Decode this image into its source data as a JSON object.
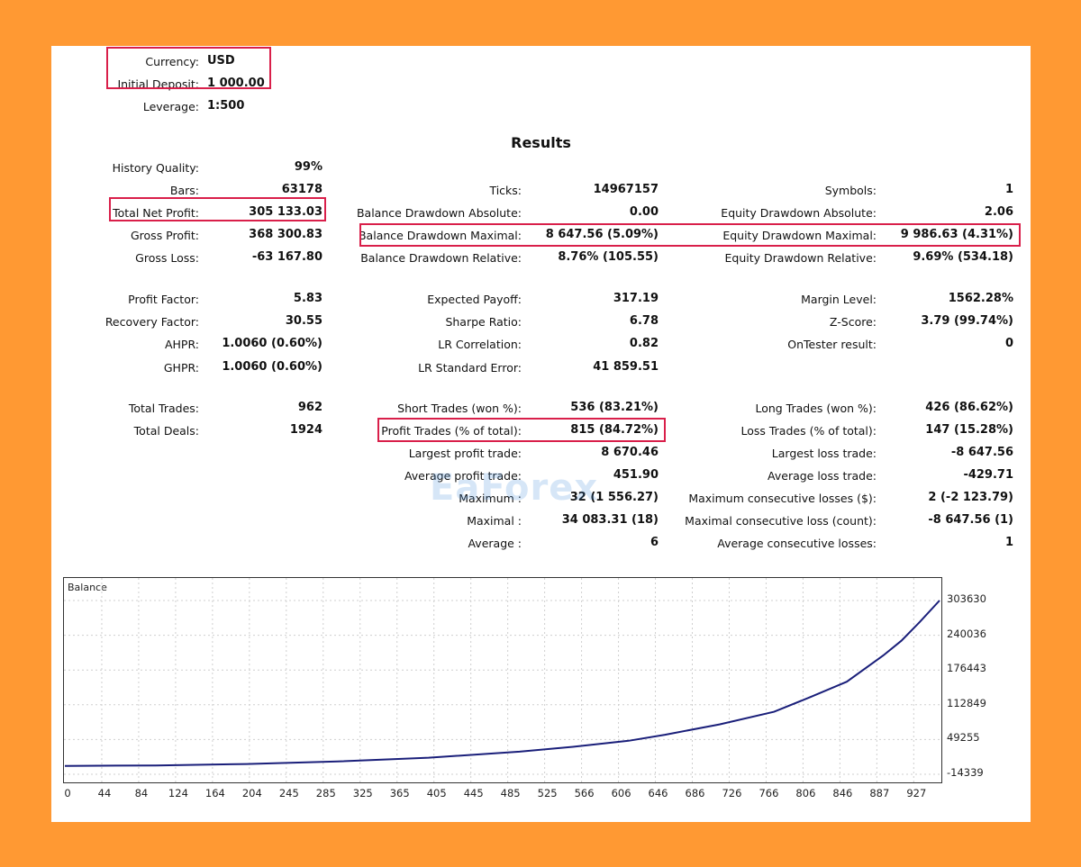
{
  "header": [
    {
      "label": "Currency:",
      "value": "USD"
    },
    {
      "label": "Initial Deposit:",
      "value": "1 000.00"
    },
    {
      "label": "Leverage:",
      "value": "1:500"
    }
  ],
  "results_title": "Results",
  "col1": [
    {
      "label": "History Quality:",
      "value": "99%"
    },
    {
      "label": "Bars:",
      "value": "63178"
    },
    {
      "label": "Total Net Profit:",
      "value": "305 133.03"
    },
    {
      "label": "Gross Profit:",
      "value": "368 300.83"
    },
    {
      "label": "Gross Loss:",
      "value": "-63 167.80"
    },
    {
      "label": "Profit Factor:",
      "value": "5.83"
    },
    {
      "label": "Recovery Factor:",
      "value": "30.55"
    },
    {
      "label": "AHPR:",
      "value": "1.0060 (0.60%)"
    },
    {
      "label": "GHPR:",
      "value": "1.0060 (0.60%)"
    },
    {
      "label": "Total Trades:",
      "value": "962"
    },
    {
      "label": "Total Deals:",
      "value": "1924"
    }
  ],
  "col2": [
    {
      "label": "Ticks:",
      "value": "14967157"
    },
    {
      "label": "Balance Drawdown Absolute:",
      "value": "0.00"
    },
    {
      "label": "Balance Drawdown Maximal:",
      "value": "8 647.56 (5.09%)"
    },
    {
      "label": "Balance Drawdown Relative:",
      "value": "8.76% (105.55)"
    },
    {
      "label": "Expected Payoff:",
      "value": "317.19"
    },
    {
      "label": "Sharpe Ratio:",
      "value": "6.78"
    },
    {
      "label": "LR Correlation:",
      "value": "0.82"
    },
    {
      "label": "LR Standard Error:",
      "value": "41 859.51"
    },
    {
      "label": "Short Trades (won %):",
      "value": "536 (83.21%)"
    },
    {
      "label": "Profit Trades (% of total):",
      "value": "815 (84.72%)"
    },
    {
      "label": "Largest profit trade:",
      "value": "8 670.46"
    },
    {
      "label": "Average profit trade:",
      "value": "451.90"
    },
    {
      "label": "Maximum :",
      "value": "32 (1 556.27)"
    },
    {
      "label": "Maximal :",
      "value": "34 083.31 (18)"
    },
    {
      "label": "Average :",
      "value": "6"
    }
  ],
  "col3": [
    {
      "label": "Symbols:",
      "value": "1"
    },
    {
      "label": "Equity Drawdown Absolute:",
      "value": "2.06"
    },
    {
      "label": "Equity Drawdown Maximal:",
      "value": "9 986.63 (4.31%)"
    },
    {
      "label": "Equity Drawdown Relative:",
      "value": "9.69% (534.18)"
    },
    {
      "label": "Margin Level:",
      "value": "1562.28%"
    },
    {
      "label": "Z-Score:",
      "value": "3.79 (99.74%)"
    },
    {
      "label": "OnTester result:",
      "value": "0"
    },
    {
      "label": "Long Trades (won %):",
      "value": "426 (86.62%)"
    },
    {
      "label": "Loss Trades (% of total):",
      "value": "147 (15.28%)"
    },
    {
      "label": "Largest loss trade:",
      "value": "-8 647.56"
    },
    {
      "label": "Average loss trade:",
      "value": "-429.71"
    },
    {
      "label": "Maximum consecutive losses ($):",
      "value": "2 (-2 123.79)"
    },
    {
      "label": "Maximal consecutive loss (count):",
      "value": "-8 647.56 (1)"
    },
    {
      "label": "Average consecutive losses:",
      "value": "1"
    }
  ],
  "watermark": "EaForex",
  "colors": {
    "highlight": "#D91F4A",
    "line": "#1A1F7A",
    "frame": "#FF9933"
  },
  "chart_data": {
    "type": "line",
    "title": "Balance",
    "x_ticks": [
      "0",
      "44",
      "84",
      "124",
      "164",
      "204",
      "245",
      "285",
      "325",
      "365",
      "405",
      "445",
      "485",
      "525",
      "566",
      "606",
      "646",
      "686",
      "726",
      "766",
      "806",
      "846",
      "887",
      "927"
    ],
    "y_ticks": [
      "303630",
      "240036",
      "176443",
      "112849",
      "49255",
      "-14339"
    ],
    "ylim": [
      -14339,
      303630
    ],
    "xlim": [
      0,
      962
    ],
    "grid": true,
    "series": [
      {
        "x": [
          0,
          100,
          200,
          300,
          400,
          500,
          560,
          620,
          660,
          720,
          780,
          820,
          860,
          900,
          920,
          940,
          962
        ],
        "y": [
          1000,
          1800,
          4500,
          9000,
          16000,
          27000,
          36000,
          47000,
          58000,
          77000,
          100000,
          127000,
          155000,
          203000,
          230000,
          264000,
          303630
        ]
      }
    ]
  }
}
